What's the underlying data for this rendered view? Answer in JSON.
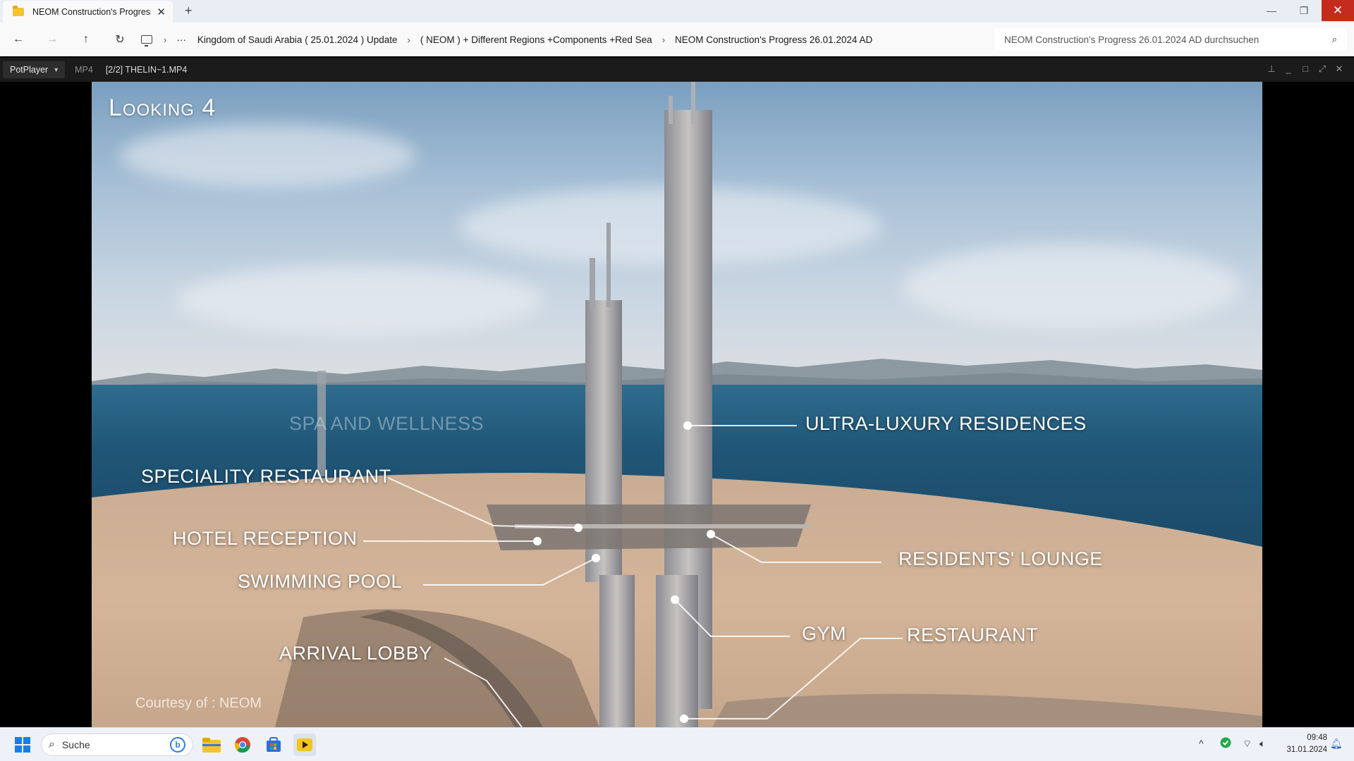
{
  "explorer": {
    "tab_title": "NEOM Construction's Progress",
    "breadcrumbs": [
      "Kingdom of Saudi Arabia ( 25.01.2024 ) Update",
      "( NEOM ) + Different Regions +Components +Red Sea",
      "NEOM Construction's Progress 26.01.2024 AD"
    ],
    "search_placeholder": "NEOM Construction's Progress 26.01.2024 AD durchsuchen"
  },
  "player": {
    "menu_label": "PotPlayer",
    "format": "MP4",
    "file_name": "[2/2] THELIN~1.MP4"
  },
  "video": {
    "title": "Looking 4",
    "labels": {
      "spa": "SPA AND WELLNESS",
      "ultra": "ULTRA-LUXURY RESIDENCES",
      "speciality": "SPECIALITY RESTAURANT",
      "hotel": "HOTEL RECEPTION",
      "pool": "SWIMMING POOL",
      "lounge": "RESIDENTS' LOUNGE",
      "gym": "GYM",
      "restaurant": "RESTAURANT",
      "lobby": "ARRIVAL LOBBY"
    },
    "courtesy": "Courtesy of : NEOM"
  },
  "taskbar": {
    "search_label": "Suche",
    "time": "09:48",
    "date": "31.01.2024"
  }
}
